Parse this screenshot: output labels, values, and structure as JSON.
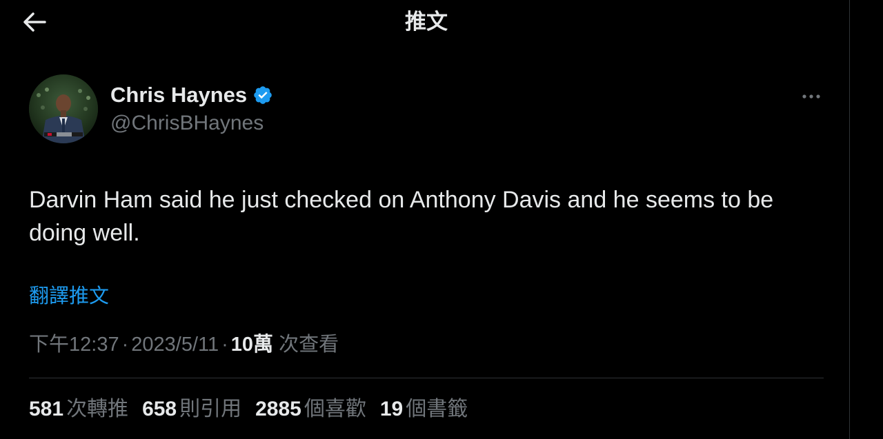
{
  "header": {
    "title": "推文"
  },
  "author": {
    "display_name": "Chris Haynes",
    "handle": "@ChrisBHaynes"
  },
  "tweet": {
    "text": "Darvin Ham said he just checked on Anthony Davis and he seems to be doing well.",
    "translate_label": "翻譯推文",
    "time": "下午12:37",
    "date": "2023/5/11",
    "separator": "·",
    "views_count": "10萬",
    "views_label": "次查看"
  },
  "stats": [
    {
      "count": "581",
      "label": "次轉推"
    },
    {
      "count": "658",
      "label": "則引用"
    },
    {
      "count": "2885",
      "label": "個喜歡"
    },
    {
      "count": "19",
      "label": "個書籤"
    }
  ],
  "colors": {
    "background": "#000000",
    "text_primary": "#e7e9ea",
    "text_secondary": "#71767b",
    "accent": "#1d9bf0",
    "divider": "#2f3336"
  },
  "icons": {
    "back": "arrow-left-icon",
    "verified": "verified-badge-icon",
    "more": "more-horizontal-icon"
  }
}
